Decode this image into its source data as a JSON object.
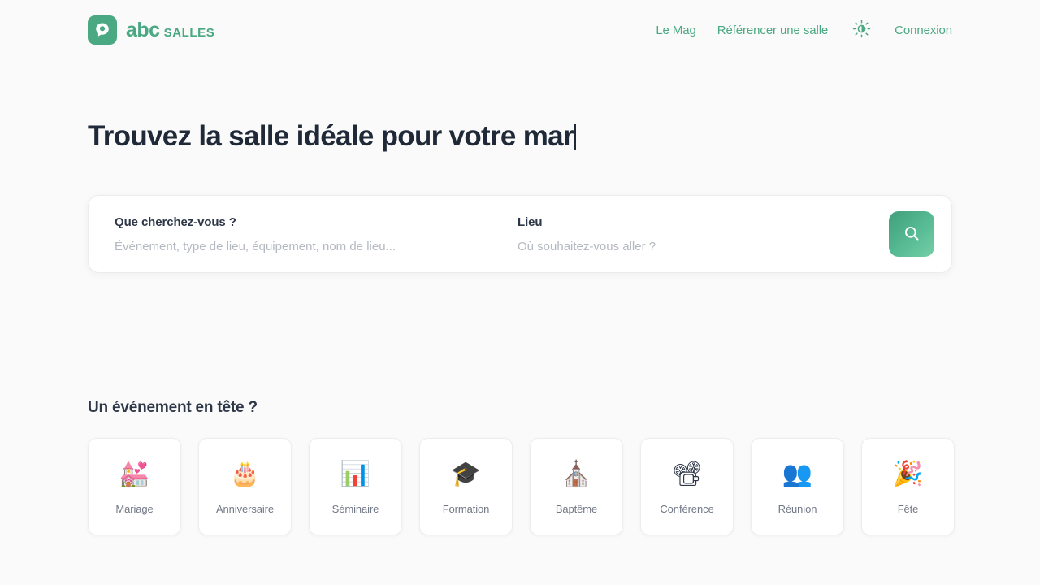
{
  "header": {
    "brand": {
      "icon": "abc-salles-logo-icon",
      "name": "abc",
      "suffix": "SALLES",
      "color": "#4aa882"
    },
    "nav": [
      {
        "label": "Le Mag",
        "name": "nav-link-le-mag"
      },
      {
        "label": "Référencer une salle",
        "name": "nav-link-referencer-une-salle"
      }
    ],
    "theme_toggle": {
      "icon": "sun-half-icon",
      "label": ""
    },
    "login": {
      "label": "Connexion",
      "name": "nav-link-connexion"
    }
  },
  "hero": {
    "title": "Trouvez la salle idéale pour votre mar",
    "typing_caret": true
  },
  "search": {
    "what": {
      "label": "Que cherchez-vous ?",
      "placeholder": "Événement, type de lieu, équipement, nom de lieu...",
      "value": ""
    },
    "where": {
      "label": "Lieu",
      "placeholder": "Où souhaitez-vous aller ?",
      "value": ""
    },
    "submit": {
      "icon": "search-icon",
      "label": "",
      "gradient_from": "#3f9f7a",
      "gradient_to": "#75cfa8"
    }
  },
  "events": {
    "title": "Un événement en tête ?",
    "items": [
      {
        "label": "Mariage",
        "emoji": "💒",
        "icon": "wedding-chapel-icon"
      },
      {
        "label": "Anniversaire",
        "emoji": "🎂",
        "icon": "birthday-cake-icon"
      },
      {
        "label": "Séminaire",
        "emoji": "📊",
        "icon": "presentation-icon"
      },
      {
        "label": "Formation",
        "emoji": "🎓",
        "icon": "graduation-cap-icon"
      },
      {
        "label": "Baptême",
        "emoji": "⛪",
        "icon": "church-icon"
      },
      {
        "label": "Conférence",
        "emoji": "📽",
        "icon": "projector-icon"
      },
      {
        "label": "Réunion",
        "emoji": "👥",
        "icon": "meeting-people-icon"
      },
      {
        "label": "Fête",
        "emoji": "🎉",
        "icon": "party-popper-icon"
      }
    ]
  }
}
